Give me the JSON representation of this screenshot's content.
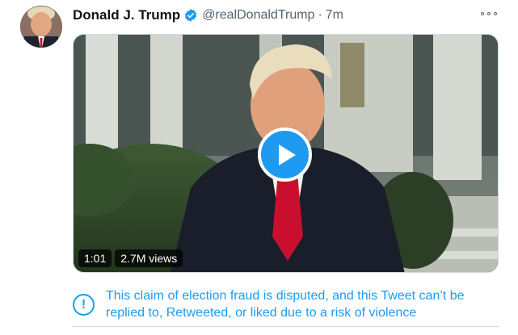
{
  "author": {
    "display_name": "Donald J. Trump",
    "handle": "@realDonaldTrump",
    "separator": "·",
    "time": "7m",
    "verified": true
  },
  "icons": {
    "verified": "verified-badge-icon",
    "more": "more-options-icon",
    "play": "play-icon",
    "notice": "exclamation-circle-icon"
  },
  "media": {
    "duration": "1:01",
    "views": "2.7M views"
  },
  "notice": {
    "icon_glyph": "!",
    "text": "This claim of election fraud is disputed, and this Tweet can’t be replied to, Retweeted, or liked due to a risk of violence"
  },
  "colors": {
    "accent": "#1d9bf0",
    "text_primary": "#0f1419",
    "text_secondary": "#536471"
  }
}
